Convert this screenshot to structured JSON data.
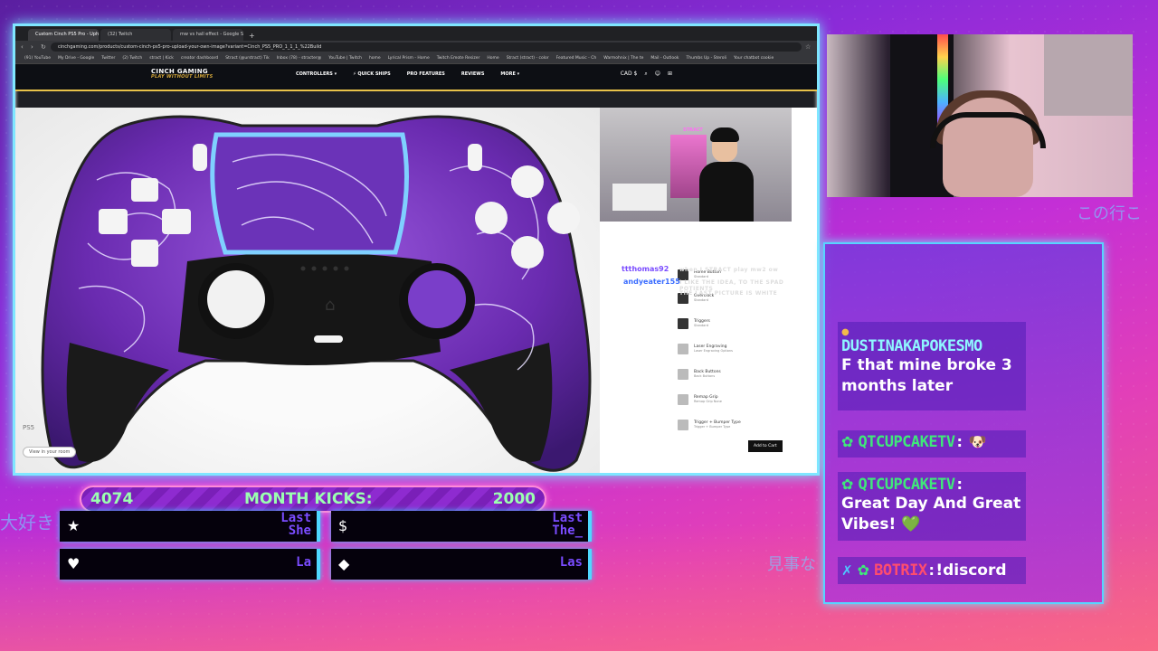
{
  "browser": {
    "tabs": [
      "Custom Cinch PS5 Pro - Upho",
      "(32) Twitch",
      "mw vs hall effect - Google Sea"
    ],
    "url": "cinchgaming.com/products/custom-cinch-ps5-pro-upload-your-own-image?variant=Cinch_PS5_PRO_1_1_1_%22Build",
    "bookmarks": [
      "(91) YouTube",
      "My Drive - Google",
      "Twitter",
      "(2) Twitch",
      "stract | Kick",
      "creator dashboard",
      "Stract (@urstract) Tik",
      "Inbox (78) - stracter@",
      "YouTube | Twitch",
      "home",
      "Lyrical Prism - Home",
      "Twitch Emote Resizer",
      "Home",
      "Stract (stract) - color",
      "Featured Music - Ch",
      "Warmohnix | The te",
      "Mail - Outlook",
      "Thumbs Up - Steroli",
      "Your chatbot cookie"
    ]
  },
  "site": {
    "logo": "CINCH GAMING",
    "logo_sub": "PLAY WITHOUT LIMITS",
    "menu": [
      "CONTROLLERS ▾",
      "⚡ QUICK SHIPS",
      "PRO FEATURES",
      "REVIEWS",
      "MORE ▾"
    ],
    "currency": "CAD $",
    "product_label": "PS5",
    "view_room": "View in your room",
    "add_to_cart": "Add to Cart",
    "options": [
      {
        "name": "Home Button",
        "sub": "Standard"
      },
      {
        "name": "Overclock",
        "sub": "Standard"
      },
      {
        "name": "Triggers",
        "sub": "Standard"
      },
      {
        "name": "Laser Engraving",
        "sub": "Laser Engraving Options"
      },
      {
        "name": "Back Buttons",
        "sub": "Back Buttons"
      },
      {
        "name": "Remap Grip",
        "sub": "Remap Grip None"
      },
      {
        "name": "Trigger + Bumper Type",
        "sub": "Trigger + Bumper Type"
      }
    ]
  },
  "stream_overlay": {
    "cam_tag": "STRACT",
    "chat_lines": [
      {
        "user": "ttthomas92",
        "text": "when I STRACT play mw2 ow"
      },
      {
        "user": "andyeater155",
        "text": "I LIKE THE IDEA, TO THE SPAD POTIENTS"
      },
      {
        "user": "",
        "text": "THE LAST PICTURE IS WHITE"
      }
    ]
  },
  "chat": {
    "messages": [
      {
        "user": "DUSTINAKAPOKESMO",
        "text": "F that mine broke 3 months later",
        "color": "#8ff6ff"
      },
      {
        "user": "QTCUPCAKETV",
        "text": "🐶",
        "color": "#3fe87a"
      },
      {
        "user": "QTCUPCAKETV",
        "text": "Great Day And Great Vibes! 💚",
        "color": "#3fe87a"
      },
      {
        "user": "BOTRIX",
        "text": "!discord",
        "color": "#ff4d6d"
      }
    ]
  },
  "goal": {
    "current": "4074",
    "label": "MONTH KICKS:",
    "target": "2000"
  },
  "alerts": [
    {
      "icon": "★",
      "text": "Last She"
    },
    {
      "icon": "$",
      "text": "Last The_"
    },
    {
      "icon": "♥",
      "text": "La"
    },
    {
      "icon": "◆",
      "text": "Las"
    }
  ],
  "deco_text": {
    "jp_left": "大好き",
    "jp_right_top": "この行こ",
    "jp_right_bottom": "見事な"
  },
  "colors": {
    "accent_cyan": "#7fe6ff",
    "accent_green": "#9bffb0",
    "bg_purple": "#8a2bd8",
    "bg_pink": "#e23fb8"
  }
}
